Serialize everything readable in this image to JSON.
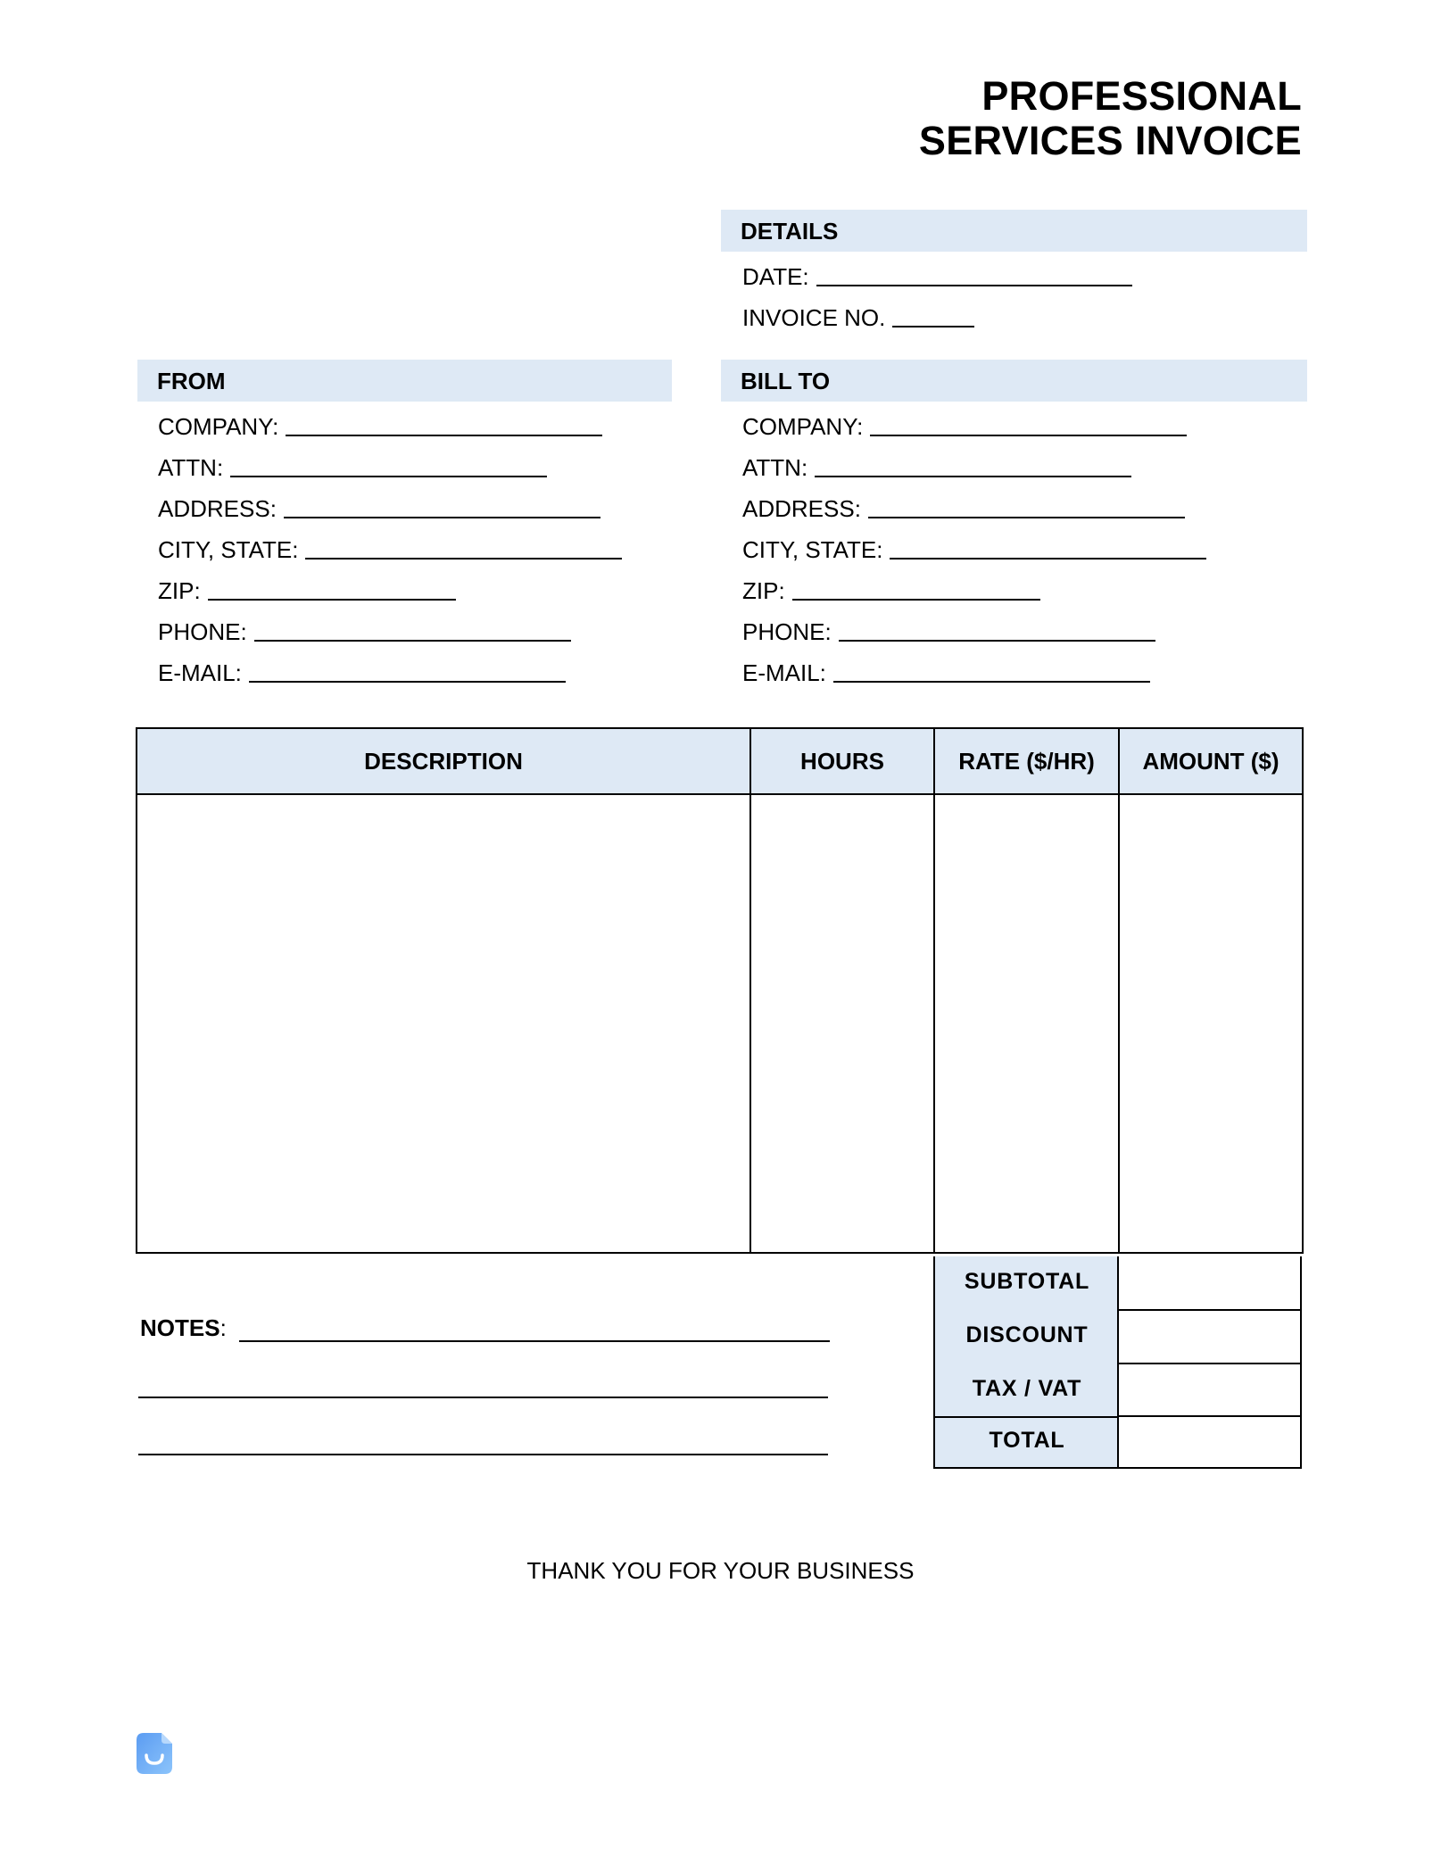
{
  "header": {
    "title_line1": "PROFESSIONAL",
    "title_line2": "SERVICES INVOICE"
  },
  "details": {
    "heading": "DETAILS",
    "fields": [
      {
        "label": "DATE:",
        "value": ""
      },
      {
        "label": "INVOICE NO.",
        "value": ""
      }
    ]
  },
  "from": {
    "heading": "FROM",
    "fields": [
      {
        "label": "COMPANY:",
        "value": ""
      },
      {
        "label": "ATTN:",
        "value": ""
      },
      {
        "label": "ADDRESS:",
        "value": ""
      },
      {
        "label": "CITY, STATE:",
        "value": ""
      },
      {
        "label": "ZIP:",
        "value": ""
      },
      {
        "label": "PHONE:",
        "value": ""
      },
      {
        "label": "E-MAIL:",
        "value": ""
      }
    ]
  },
  "bill_to": {
    "heading": "BILL TO",
    "fields": [
      {
        "label": "COMPANY:",
        "value": ""
      },
      {
        "label": "ATTN:",
        "value": ""
      },
      {
        "label": "ADDRESS:",
        "value": ""
      },
      {
        "label": "CITY, STATE:",
        "value": ""
      },
      {
        "label": "ZIP:",
        "value": ""
      },
      {
        "label": "PHONE:",
        "value": ""
      },
      {
        "label": "E-MAIL:",
        "value": ""
      }
    ]
  },
  "items_table": {
    "columns": [
      "DESCRIPTION",
      "HOURS",
      "RATE ($/HR)",
      "AMOUNT ($)"
    ],
    "rows": []
  },
  "summary": {
    "rows": [
      {
        "label": "SUBTOTAL",
        "value": ""
      },
      {
        "label": "DISCOUNT",
        "value": ""
      },
      {
        "label": "TAX / VAT",
        "value": ""
      },
      {
        "label": "TOTAL",
        "value": ""
      }
    ]
  },
  "notes": {
    "label": "NOTES",
    "colon": ":",
    "value": ""
  },
  "footer": {
    "thanks": "THANK YOU FOR YOUR BUSINESS",
    "logo_icon": "smiling-document-icon"
  },
  "colors": {
    "header_fill": "#dee9f5",
    "logo_blue": "#6aa8f5",
    "text": "#000000"
  }
}
